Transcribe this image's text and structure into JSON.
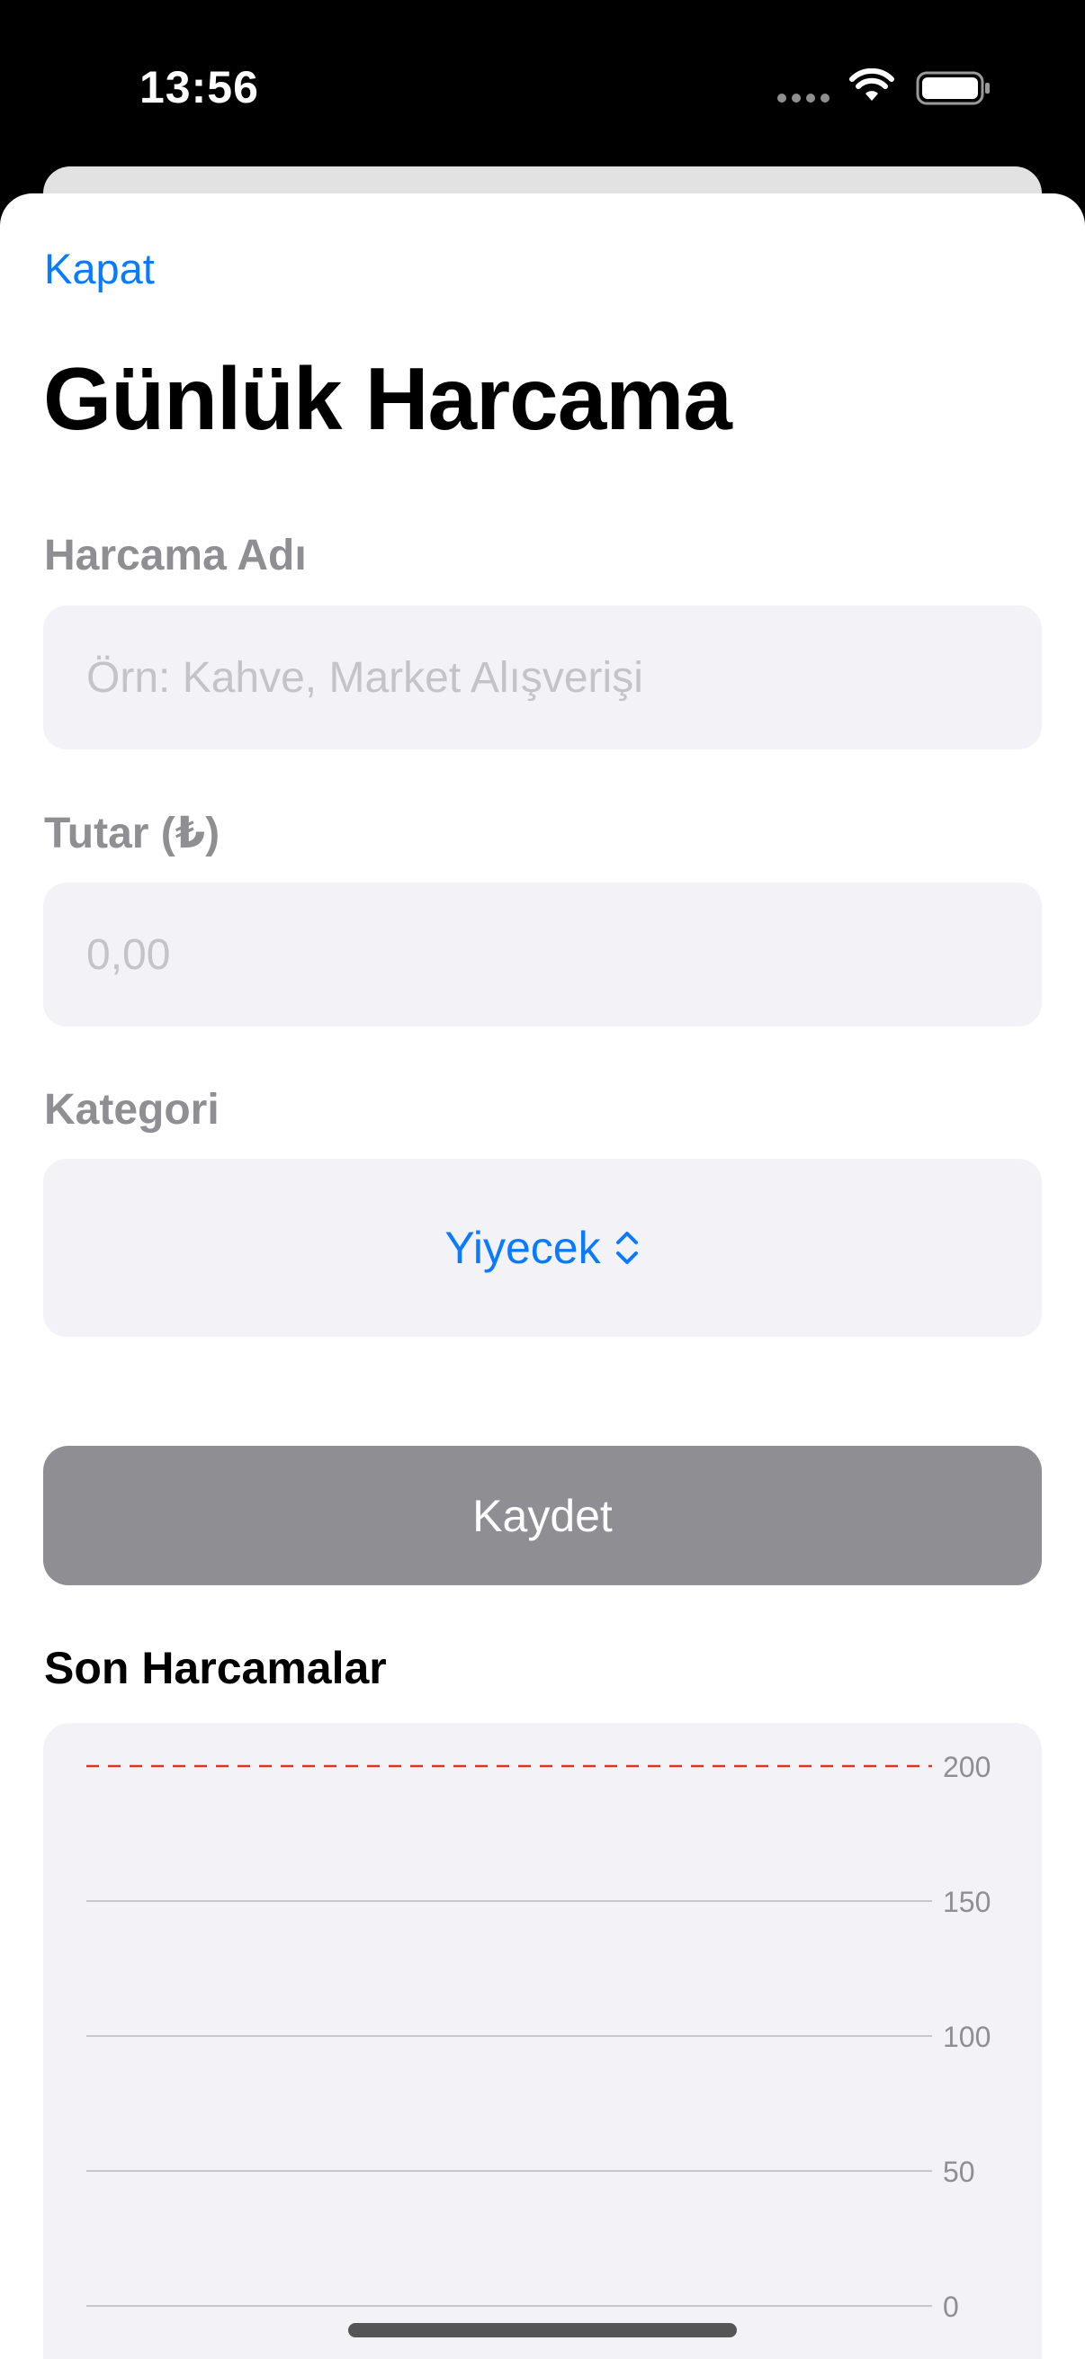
{
  "status_bar": {
    "time": "13:56"
  },
  "header": {
    "close_label": "Kapat",
    "title": "Günlük Harcama"
  },
  "form": {
    "name": {
      "label": "Harcama Adı",
      "placeholder": "Örn: Kahve, Market Alışverişi",
      "value": ""
    },
    "amount": {
      "label": "Tutar (₺)",
      "placeholder": "0,00",
      "value": ""
    },
    "category": {
      "label": "Kategori",
      "selected": "Yiyecek"
    },
    "save_label": "Kaydet"
  },
  "recent": {
    "title": "Son Harcamalar"
  },
  "colors": {
    "accent": "#0a7aff",
    "limit_line": "#e0341f",
    "button_disabled": "#8e8e93"
  },
  "chart_data": {
    "type": "bar",
    "categories": [],
    "values": [],
    "y_ticks": [
      "200",
      "150",
      "100",
      "50",
      "0"
    ],
    "ylim": [
      0,
      200
    ],
    "limit_line": 200,
    "grid": true,
    "y_axis_side": "right"
  }
}
